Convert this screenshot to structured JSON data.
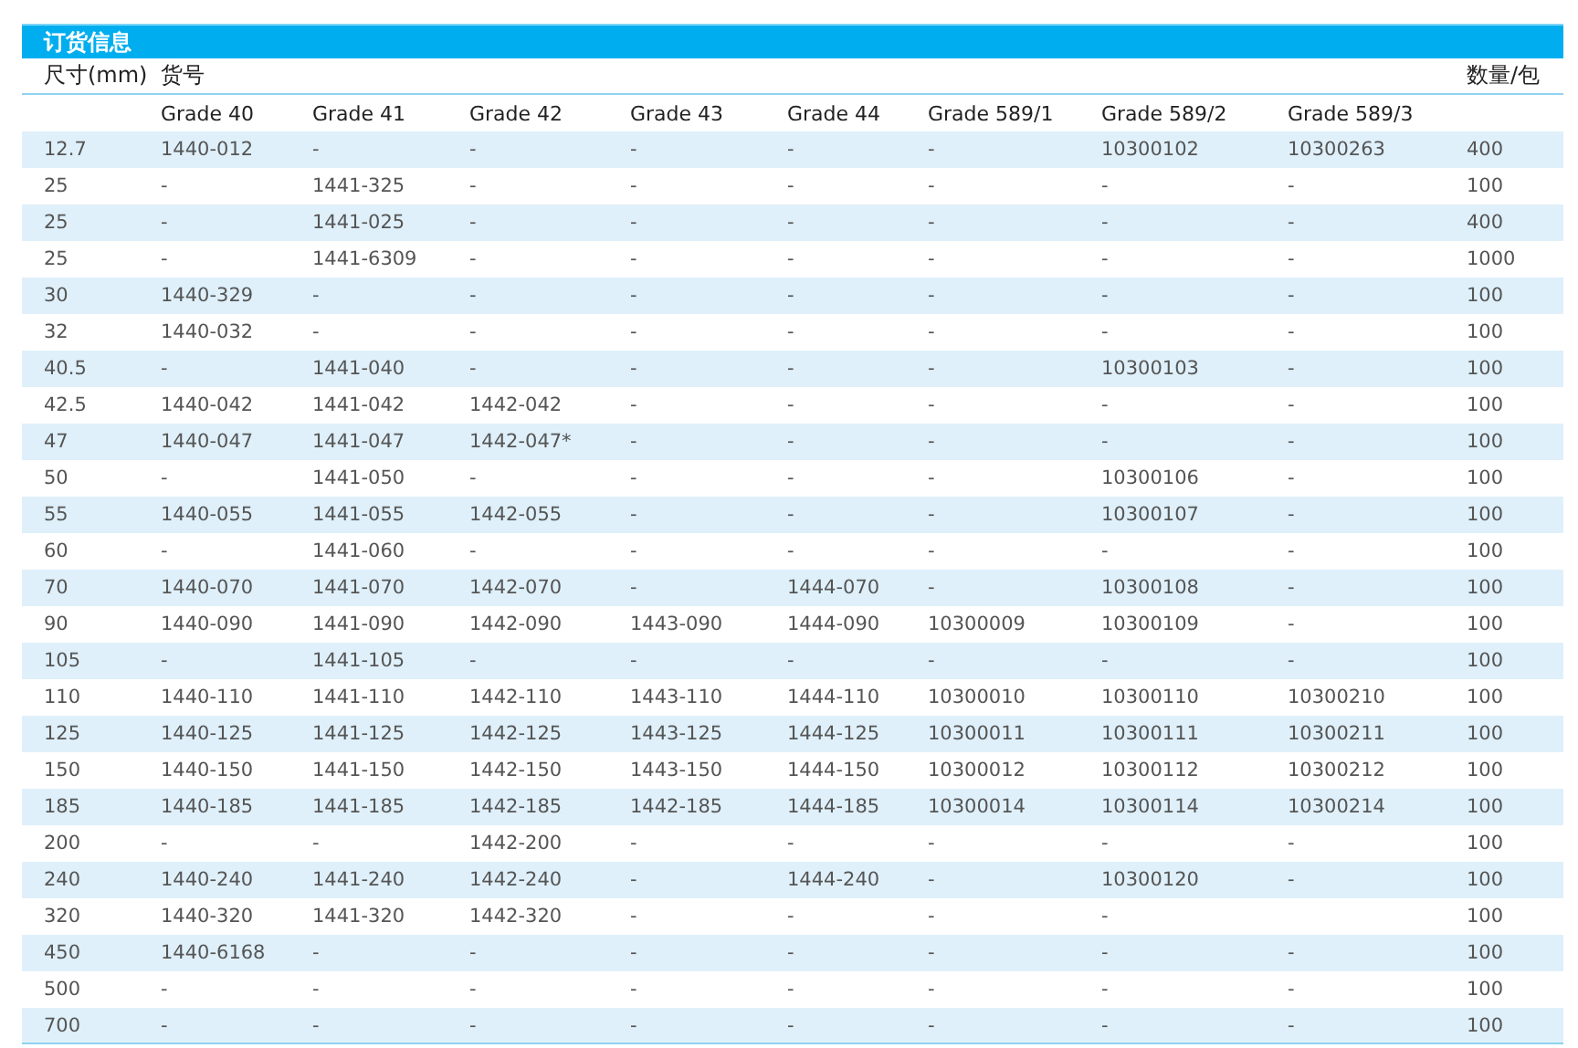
{
  "title": "订货信息",
  "header": {
    "size_label": "尺寸(mm)",
    "code_label": "货号",
    "qty_label": "数量/包"
  },
  "grades": [
    "Grade 40",
    "Grade 41",
    "Grade 42",
    "Grade 43",
    "Grade 44",
    "Grade 589/1",
    "Grade 589/2",
    "Grade 589/3"
  ],
  "rows": [
    {
      "size": "12.7",
      "codes": [
        "1440-012",
        "-",
        "-",
        "-",
        "-",
        "-",
        "10300102",
        "10300263"
      ],
      "qty": "400"
    },
    {
      "size": "25",
      "codes": [
        "-",
        "1441-325",
        "-",
        "-",
        "-",
        "-",
        "-",
        "-"
      ],
      "qty": "100"
    },
    {
      "size": "25",
      "codes": [
        "-",
        "1441-025",
        "-",
        "-",
        "-",
        "-",
        "-",
        "-"
      ],
      "qty": "400"
    },
    {
      "size": "25",
      "codes": [
        "-",
        "1441-6309",
        "-",
        "-",
        "-",
        "-",
        "-",
        "-"
      ],
      "qty": "1000"
    },
    {
      "size": "30",
      "codes": [
        "1440-329",
        "-",
        "-",
        "-",
        "-",
        "-",
        "-",
        "-"
      ],
      "qty": "100"
    },
    {
      "size": "32",
      "codes": [
        "1440-032",
        "-",
        "-",
        "-",
        "-",
        "-",
        "-",
        "-"
      ],
      "qty": "100"
    },
    {
      "size": "40.5",
      "codes": [
        "-",
        "1441-040",
        "-",
        "-",
        "-",
        "-",
        "10300103",
        "-"
      ],
      "qty": "100"
    },
    {
      "size": "42.5",
      "codes": [
        "1440-042",
        "1441-042",
        "1442-042",
        "-",
        "-",
        "-",
        "-",
        "-"
      ],
      "qty": "100"
    },
    {
      "size": "47",
      "codes": [
        "1440-047",
        "1441-047",
        "1442-047*",
        "-",
        "-",
        "-",
        "-",
        "-"
      ],
      "qty": "100"
    },
    {
      "size": "50",
      "codes": [
        "-",
        "1441-050",
        "-",
        "-",
        "-",
        "-",
        "10300106",
        "-"
      ],
      "qty": "100"
    },
    {
      "size": "55",
      "codes": [
        "1440-055",
        "1441-055",
        "1442-055",
        "-",
        "-",
        "-",
        "10300107",
        "-"
      ],
      "qty": "100"
    },
    {
      "size": "60",
      "codes": [
        "-",
        "1441-060",
        "-",
        "-",
        "-",
        "-",
        "-",
        "-"
      ],
      "qty": "100"
    },
    {
      "size": "70",
      "codes": [
        "1440-070",
        "1441-070",
        "1442-070",
        "-",
        "1444-070",
        "-",
        "10300108",
        "-"
      ],
      "qty": "100"
    },
    {
      "size": "90",
      "codes": [
        "1440-090",
        "1441-090",
        "1442-090",
        "1443-090",
        "1444-090",
        "10300009",
        "10300109",
        "-"
      ],
      "qty": "100"
    },
    {
      "size": "105",
      "codes": [
        "-",
        "1441-105",
        "-",
        "-",
        "-",
        "-",
        "-",
        "-"
      ],
      "qty": "100"
    },
    {
      "size": "110",
      "codes": [
        "1440-110",
        "1441-110",
        "1442-110",
        "1443-110",
        "1444-110",
        "10300010",
        "10300110",
        "10300210"
      ],
      "qty": "100"
    },
    {
      "size": "125",
      "codes": [
        "1440-125",
        "1441-125",
        "1442-125",
        "1443-125",
        "1444-125",
        "10300011",
        "10300111",
        "10300211"
      ],
      "qty": "100"
    },
    {
      "size": "150",
      "codes": [
        "1440-150",
        "1441-150",
        "1442-150",
        "1443-150",
        "1444-150",
        "10300012",
        "10300112",
        "10300212"
      ],
      "qty": "100"
    },
    {
      "size": "185",
      "codes": [
        "1440-185",
        "1441-185",
        "1442-185",
        "1442-185",
        "1444-185",
        "10300014",
        "10300114",
        "10300214"
      ],
      "qty": "100"
    },
    {
      "size": "200",
      "codes": [
        "-",
        "-",
        "1442-200",
        "-",
        "-",
        "-",
        "-",
        "-"
      ],
      "qty": "100"
    },
    {
      "size": "240",
      "codes": [
        "1440-240",
        "1441-240",
        "1442-240",
        "-",
        "1444-240",
        "-",
        "10300120",
        "-"
      ],
      "qty": "100"
    },
    {
      "size": "320",
      "codes": [
        "1440-320",
        "1441-320",
        "1442-320",
        "-",
        "-",
        "-",
        "-"
      ],
      "qty": "100"
    },
    {
      "size": "450",
      "codes": [
        "1440-6168",
        "-",
        "-",
        "-",
        "-",
        "-",
        "-",
        "-"
      ],
      "qty": "100"
    },
    {
      "size": "500",
      "codes": [
        "-",
        "-",
        "-",
        "-",
        "-",
        "-",
        "-",
        "-"
      ],
      "qty": "100"
    },
    {
      "size": "700",
      "codes": [
        "-",
        "-",
        "-",
        "-",
        "-",
        "-",
        "-",
        "-"
      ],
      "qty": "100"
    }
  ]
}
